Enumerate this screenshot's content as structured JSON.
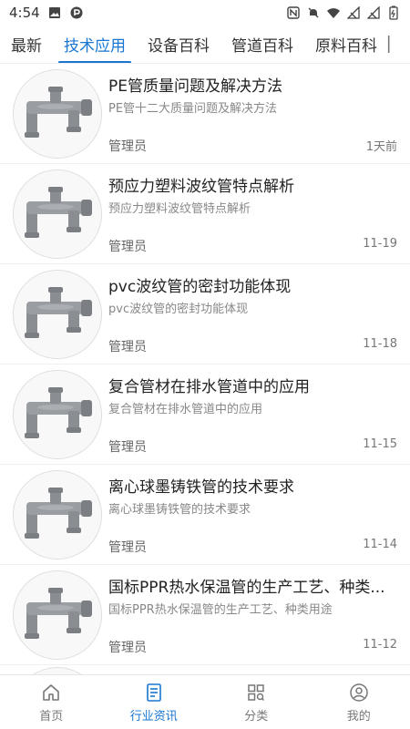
{
  "status_bar": {
    "time": "4:54",
    "icons": [
      "image-icon",
      "p-app-icon",
      "nfc-icon",
      "mute-icon",
      "wifi-icon",
      "signal-icon",
      "signal-icon",
      "battery-icon"
    ]
  },
  "tabs": [
    {
      "label": "最新"
    },
    {
      "label": "技术应用",
      "active": true
    },
    {
      "label": "设备百科"
    },
    {
      "label": "管道百科"
    },
    {
      "label": "原料百科"
    }
  ],
  "articles": [
    {
      "title": "PE管质量问题及解决方法",
      "summary": "PE管十二大质量问题及解决方法",
      "author": "管理员",
      "date": "1天前"
    },
    {
      "title": "预应力塑料波纹管特点解析",
      "summary": "预应力塑料波纹管特点解析",
      "author": "管理员",
      "date": "11-19"
    },
    {
      "title": "pvc波纹管的密封功能体现",
      "summary": "pvc波纹管的密封功能体现",
      "author": "管理员",
      "date": "11-18"
    },
    {
      "title": "复合管材在排水管道中的应用",
      "summary": "复合管材在排水管道中的应用",
      "author": "管理员",
      "date": "11-15"
    },
    {
      "title": "离心球墨铸铁管的技术要求",
      "summary": "离心球墨铸铁管的技术要求",
      "author": "管理员",
      "date": "11-14"
    },
    {
      "title": "国标PPR热水保温管的生产工艺、种类...",
      "summary": "国标PPR热水保温管的生产工艺、种类用途",
      "author": "管理员",
      "date": "11-12"
    }
  ],
  "bottom_nav": [
    {
      "label": "首页",
      "icon": "home-icon"
    },
    {
      "label": "行业资讯",
      "icon": "news-icon",
      "active": true
    },
    {
      "label": "分类",
      "icon": "category-icon"
    },
    {
      "label": "我的",
      "icon": "profile-icon"
    }
  ],
  "colors": {
    "accent": "#1976d2"
  }
}
